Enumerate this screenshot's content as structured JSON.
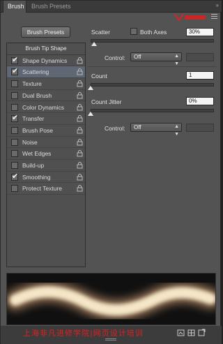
{
  "tabs": {
    "active": "Brush",
    "inactive": "Brush Presets"
  },
  "presets_button": "Brush Presets",
  "list": {
    "header": "Brush Tip Shape",
    "items": [
      {
        "label": "Shape Dynamics",
        "checked": true,
        "selected": false
      },
      {
        "label": "Scattering",
        "checked": true,
        "selected": true
      },
      {
        "label": "Texture",
        "checked": false,
        "selected": false
      },
      {
        "label": "Dual Brush",
        "checked": false,
        "selected": false
      },
      {
        "label": "Color Dynamics",
        "checked": false,
        "selected": false
      },
      {
        "label": "Transfer",
        "checked": true,
        "selected": false
      },
      {
        "label": "Brush Pose",
        "checked": false,
        "selected": false
      },
      {
        "label": "Noise",
        "checked": false,
        "selected": false
      },
      {
        "label": "Wet Edges",
        "checked": false,
        "selected": false
      },
      {
        "label": "Build-up",
        "checked": false,
        "selected": false
      },
      {
        "label": "Smoothing",
        "checked": true,
        "selected": false
      },
      {
        "label": "Protect Texture",
        "checked": false,
        "selected": false
      }
    ]
  },
  "scatter": {
    "label": "Scatter",
    "both_axes_label": "Both Axes",
    "both_axes_checked": false,
    "value": "30%",
    "slider_fraction": 0.03,
    "control_label": "Control:",
    "control_value": "Off"
  },
  "count": {
    "label": "Count",
    "value": "1",
    "slider_fraction": 0.0
  },
  "count_jitter": {
    "label": "Count Jitter",
    "value": "0%",
    "slider_fraction": 0.0,
    "control_label": "Control:",
    "control_value": "Off"
  },
  "watermark": "上海非凡进修学院|网页设计培训",
  "colors": {
    "panel": "#535353",
    "selected_row": "#5f6774",
    "watermark": "#e02020"
  }
}
